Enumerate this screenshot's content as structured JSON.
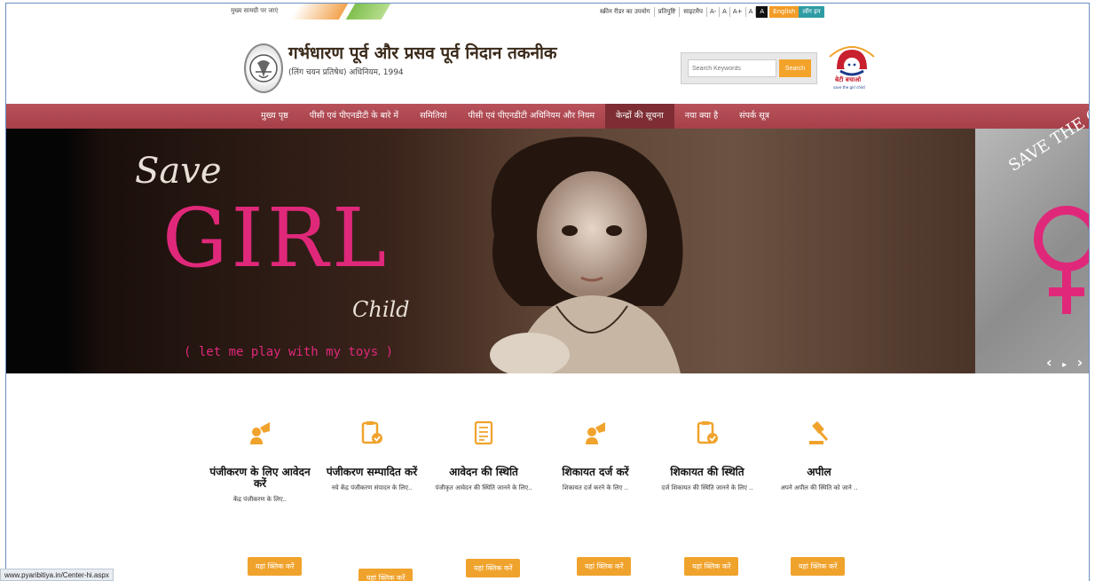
{
  "topbar": {
    "skip_link": "मुख्य सामग्री पर जाएं",
    "screen_reader": "स्क्रीन रीडर का उपयोग",
    "feedback": "प्रतिपुष्टि",
    "sitemap": "साइटमैप",
    "font_small": "A-",
    "font_normal": "A",
    "font_large": "A+",
    "contrast_normal": "A",
    "contrast_dark": "A",
    "language": "English",
    "login": "लॉग इन"
  },
  "header": {
    "title": "गर्भधारण पूर्व और प्रसव पूर्व निदान तकनीक",
    "subtitle": "(लिंग चयन प्रतिषेध) अधिनियम, 1994",
    "search_placeholder": "Search Keywords",
    "search_button": "Search",
    "logo_text": "बेटी बचाओ",
    "logo_subtext": "save the girl child"
  },
  "nav": {
    "items": [
      {
        "label": "मुख्य पृष्ठ"
      },
      {
        "label": "पीसी एवं पीएनडीटी के बारे में"
      },
      {
        "label": "समितियां"
      },
      {
        "label": "पीसी एवं पीएनडीटी अधिनियम और नियम"
      },
      {
        "label": "केन्द्रों की सूचना"
      },
      {
        "label": "नया क्या है"
      },
      {
        "label": "संपर्क सूत्र"
      }
    ],
    "active_index": 4
  },
  "banner": {
    "save": "Save",
    "girl": "GIRL",
    "child": "Child",
    "tagline": "( let me play with my toys )",
    "side_text": "SAVE THE GI",
    "prev": "‹",
    "play": "▸",
    "next": "›"
  },
  "cards": [
    {
      "title": "पंजीकरण के लिए आवेदन करें",
      "desc": "केंद्र पंजीकरण के लिए..",
      "button": "यहां क्लिक करें",
      "icon": "user-apply-icon"
    },
    {
      "title": "पंजीकरण सम्पादित करें",
      "desc": "नये केंद्र पंजीकरण संपादन के लिए..",
      "button": "यहां क्लिक करें",
      "icon": "clipboard-check-icon"
    },
    {
      "title": "आवेदन की स्थिति",
      "desc": "पंजीकृत आवेदन की स्थिति जानने के लिए..",
      "button": "यहां क्लिक करें",
      "icon": "document-list-icon"
    },
    {
      "title": "शिकायत दर्ज करें",
      "desc": "शिकायत दर्ज करने के लिए ..",
      "button": "यहां क्लिक करें",
      "icon": "user-complaint-icon"
    },
    {
      "title": "शिकायत की स्थिति",
      "desc": "दर्ज शिकायत की स्थिति जानने के लिए ..",
      "button": "यहां क्लिक करें",
      "icon": "clipboard-check-icon"
    },
    {
      "title": "अपील",
      "desc": "अपने अपील की स्थिति को जाने ..",
      "button": "यहां क्लिक करें",
      "icon": "gavel-icon"
    }
  ],
  "status_bar": "www.pyaribitiya.in/Center-hi.aspx",
  "colors": {
    "nav_bg": "#ad4750",
    "accent": "#f0a32c",
    "pink": "#e0287a",
    "login_bg": "#2e9ca4"
  }
}
